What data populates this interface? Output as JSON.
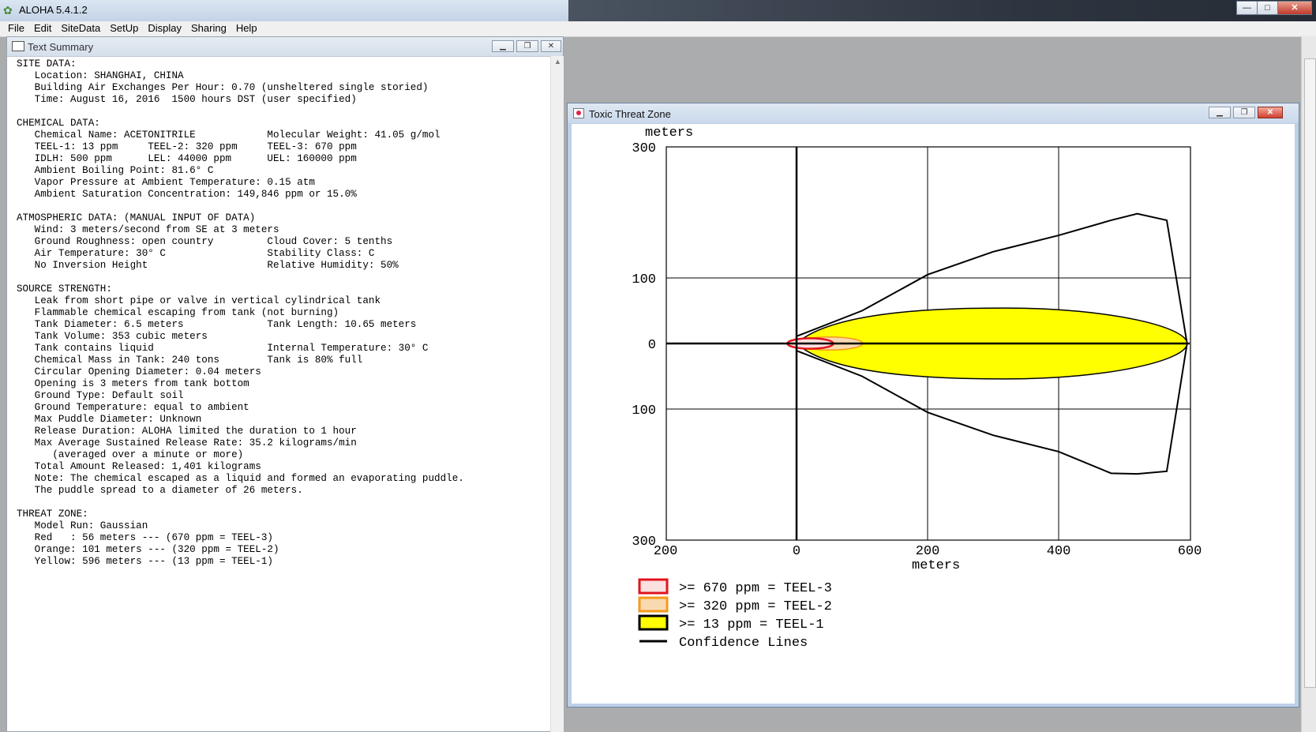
{
  "app": {
    "title": "ALOHA 5.4.1.2",
    "min": "—",
    "max": "□",
    "close": "✕"
  },
  "menu": [
    "File",
    "Edit",
    "SiteData",
    "SetUp",
    "Display",
    "Sharing",
    "Help"
  ],
  "text_summary": {
    "title": "Text Summary",
    "lines": [
      "SITE DATA:",
      "   Location: SHANGHAI, CHINA",
      "   Building Air Exchanges Per Hour: 0.70 (unsheltered single storied)",
      "   Time: August 16, 2016  1500 hours DST (user specified)",
      "",
      "CHEMICAL DATA:",
      "   Chemical Name: ACETONITRILE            Molecular Weight: 41.05 g/mol",
      "   TEEL-1: 13 ppm     TEEL-2: 320 ppm     TEEL-3: 670 ppm",
      "   IDLH: 500 ppm      LEL: 44000 ppm      UEL: 160000 ppm",
      "   Ambient Boiling Point: 81.6° C",
      "   Vapor Pressure at Ambient Temperature: 0.15 atm",
      "   Ambient Saturation Concentration: 149,846 ppm or 15.0%",
      "",
      "ATMOSPHERIC DATA: (MANUAL INPUT OF DATA)",
      "   Wind: 3 meters/second from SE at 3 meters",
      "   Ground Roughness: open country         Cloud Cover: 5 tenths",
      "   Air Temperature: 30° C                 Stability Class: C",
      "   No Inversion Height                    Relative Humidity: 50%",
      "",
      "SOURCE STRENGTH:",
      "   Leak from short pipe or valve in vertical cylindrical tank",
      "   Flammable chemical escaping from tank (not burning)",
      "   Tank Diameter: 6.5 meters              Tank Length: 10.65 meters",
      "   Tank Volume: 353 cubic meters",
      "   Tank contains liquid                   Internal Temperature: 30° C",
      "   Chemical Mass in Tank: 240 tons        Tank is 80% full",
      "   Circular Opening Diameter: 0.04 meters",
      "   Opening is 3 meters from tank bottom",
      "   Ground Type: Default soil",
      "   Ground Temperature: equal to ambient",
      "   Max Puddle Diameter: Unknown",
      "   Release Duration: ALOHA limited the duration to 1 hour",
      "   Max Average Sustained Release Rate: 35.2 kilograms/min",
      "      (averaged over a minute or more)",
      "   Total Amount Released: 1,401 kilograms",
      "   Note: The chemical escaped as a liquid and formed an evaporating puddle.",
      "   The puddle spread to a diameter of 26 meters.",
      "",
      "THREAT ZONE:",
      "   Model Run: Gaussian",
      "   Red   : 56 meters --- (670 ppm = TEEL-3)",
      "   Orange: 101 meters --- (320 ppm = TEEL-2)",
      "   Yellow: 596 meters --- (13 ppm = TEEL-1)"
    ]
  },
  "threat_zone": {
    "title": "Toxic Threat Zone",
    "y_unit": "meters",
    "x_unit": "meters",
    "y_tick_labels": [
      "300",
      "100",
      "0",
      "100",
      "300"
    ],
    "x_tick_labels": [
      "200",
      "0",
      "200",
      "400",
      "600"
    ],
    "legend": [
      {
        "label": ">= 670 ppm = TEEL-3",
        "color": "#e0141e"
      },
      {
        "label": ">= 320 ppm = TEEL-2",
        "color": "#f59a1b"
      },
      {
        "label": ">= 13 ppm = TEEL-1",
        "color": "#ffff00"
      },
      {
        "label": "Confidence Lines",
        "color": "#000000"
      }
    ]
  },
  "chart_data": {
    "type": "area",
    "xlabel": "meters",
    "ylabel": "meters",
    "xlim": [
      -200,
      600
    ],
    "ylim": [
      -300,
      300
    ],
    "x_ticks": [
      -200,
      0,
      200,
      400,
      600
    ],
    "y_ticks": [
      -300,
      -100,
      0,
      100,
      300
    ],
    "grid": true,
    "series": [
      {
        "name": ">= 670 ppm = TEEL-3",
        "color": "#e0141e",
        "extent_x": [
          -14,
          56
        ],
        "half_width": 8
      },
      {
        "name": ">= 320 ppm = TEEL-2",
        "color": "#f59a1b",
        "extent_x": [
          0,
          101
        ],
        "half_width": 10
      },
      {
        "name": ">= 13 ppm = TEEL-1",
        "color": "#ffff00",
        "extent_x": [
          0,
          596
        ],
        "half_width": 54
      },
      {
        "name": "Confidence Lines",
        "color": "#000000",
        "upper": [
          [
            0,
            11
          ],
          [
            100,
            50
          ],
          [
            200,
            105
          ],
          [
            300,
            140
          ],
          [
            400,
            165
          ],
          [
            480,
            188
          ],
          [
            520,
            198
          ],
          [
            565,
            188
          ],
          [
            596,
            0
          ]
        ],
        "lower": [
          [
            0,
            -11
          ],
          [
            100,
            -50
          ],
          [
            200,
            -105
          ],
          [
            300,
            -140
          ],
          [
            400,
            -165
          ],
          [
            480,
            -198
          ],
          [
            520,
            -199
          ],
          [
            565,
            -195
          ],
          [
            596,
            0
          ]
        ]
      }
    ]
  }
}
